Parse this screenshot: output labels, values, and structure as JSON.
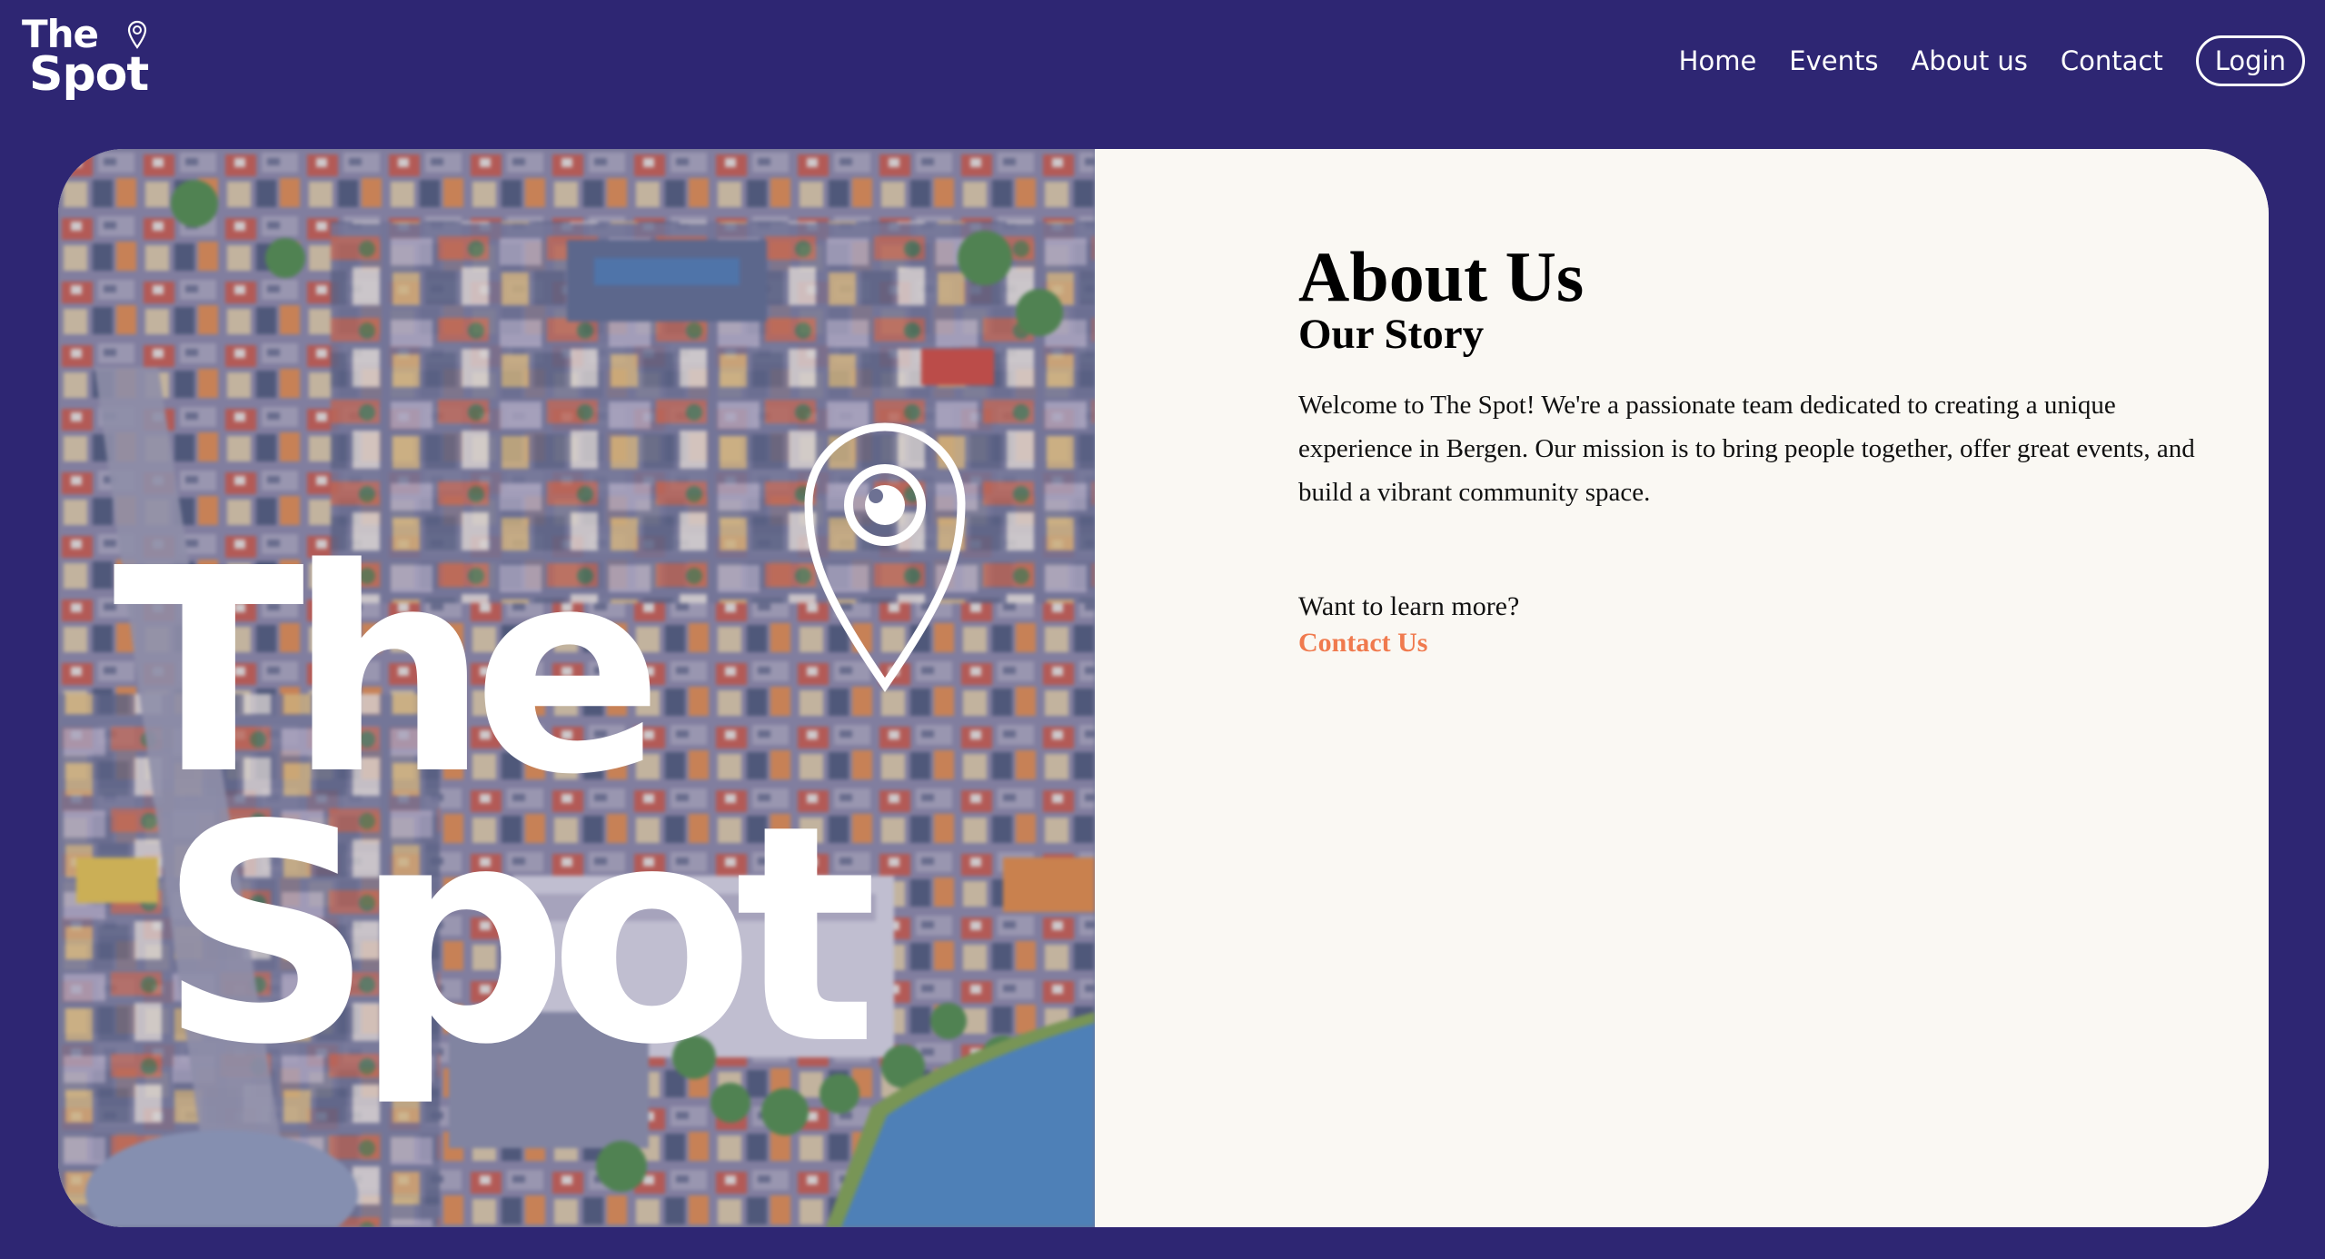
{
  "header": {
    "logo": {
      "line1": "The",
      "line2": "Spot"
    },
    "nav": {
      "items": [
        {
          "label": "Home"
        },
        {
          "label": "Events"
        },
        {
          "label": "About us"
        },
        {
          "label": "Contact"
        }
      ],
      "login_label": "Login"
    }
  },
  "hero": {
    "logo_line1": "The",
    "logo_line2": "Spot",
    "icon": "location-pin-icon",
    "image": "aerial-city-photo"
  },
  "about": {
    "title": "About Us",
    "subtitle": "Our Story",
    "body": "Welcome to The Spot! We're a passionate team dedicated to creating a unique experience in Bergen. Our mission is to bring people together, offer great events, and build a vibrant community space.",
    "learn_more": "Want to learn more?",
    "contact_link": "Contact Us"
  },
  "colors": {
    "background": "#2e2673",
    "panel": "#faf8f3",
    "accent": "#f07a4e",
    "text": "#111111"
  }
}
